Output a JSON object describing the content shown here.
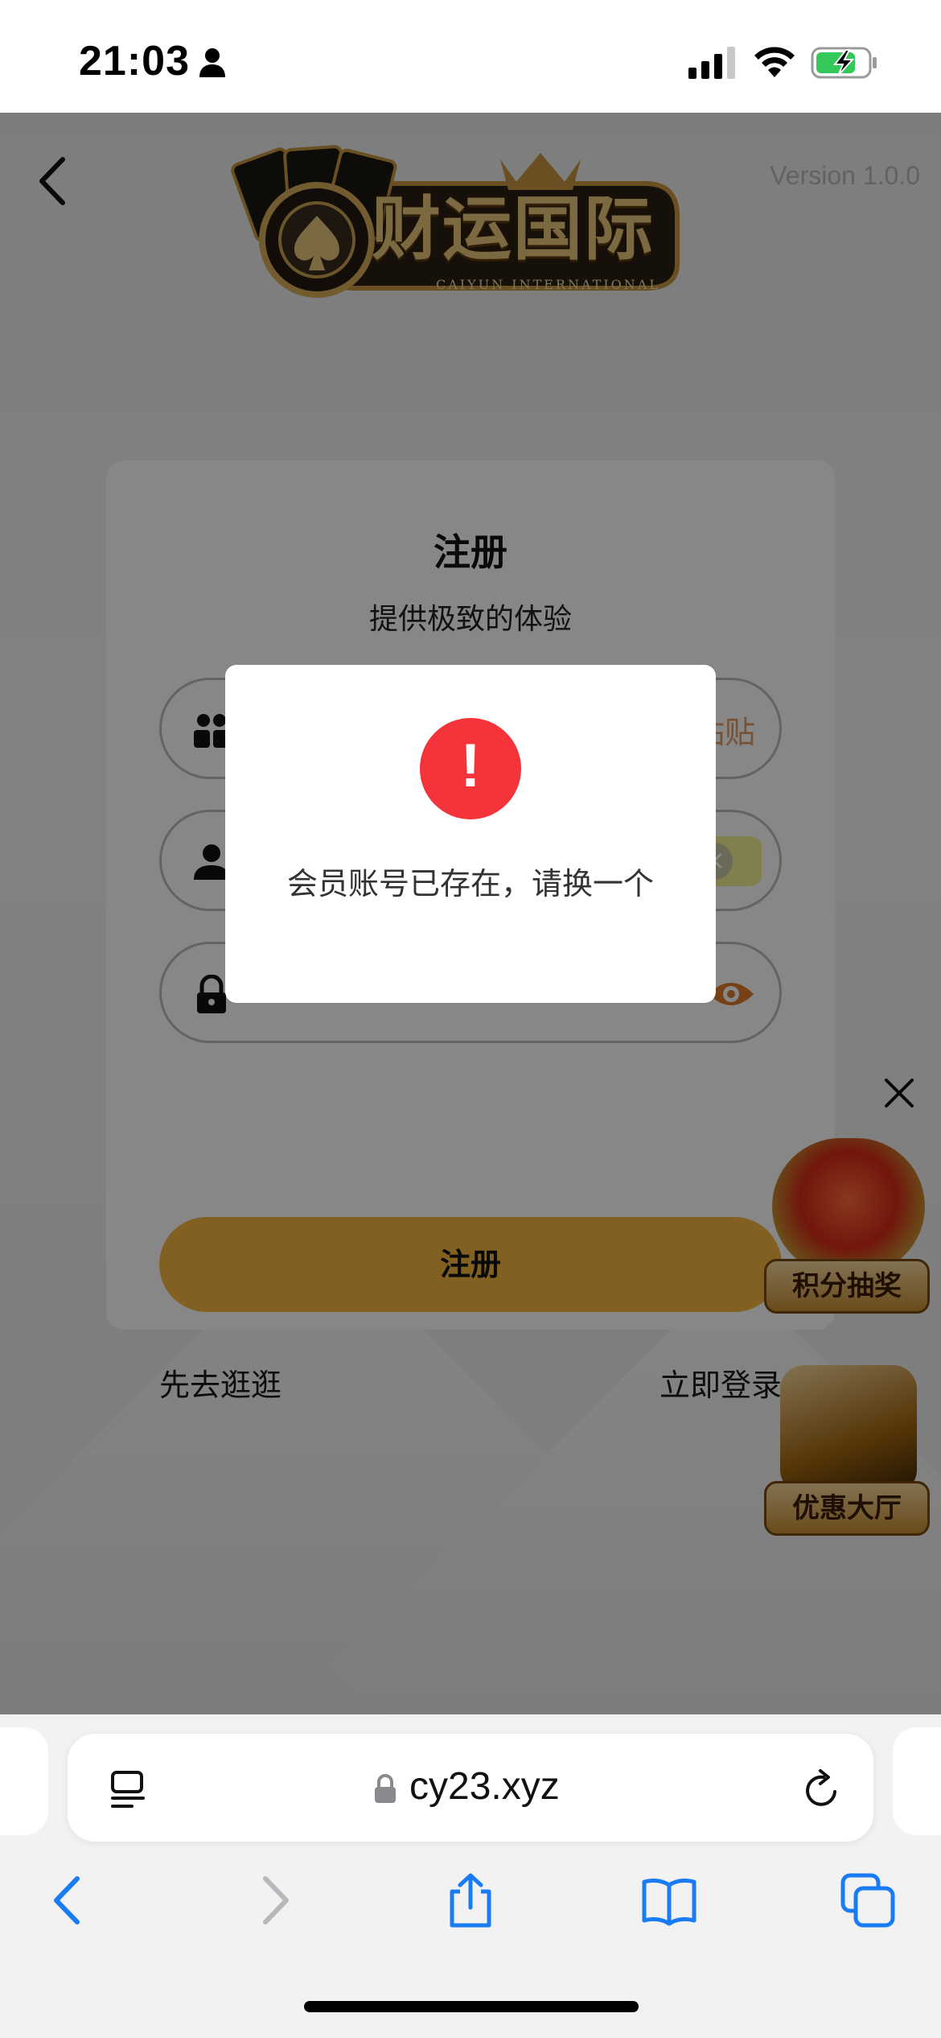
{
  "status_bar": {
    "time": "21:03"
  },
  "page": {
    "version": "Version 1.0.0",
    "logo": {
      "title": "财运国际",
      "subtitle": "CAIYUN INTERNATIONAL"
    },
    "form": {
      "title": "注册",
      "subtitle": "提供极致的体验",
      "field1_right": "粘贴",
      "submit_label": "注册",
      "browse_link": "先去逛逛",
      "login_link": "立即登录"
    },
    "promos": [
      {
        "label": "积分抽奖"
      },
      {
        "label": "优惠大厅"
      }
    ]
  },
  "modal": {
    "icon_text": "!",
    "message": "会员账号已存在，请换一个"
  },
  "browser": {
    "url": "cy23.xyz"
  },
  "colors": {
    "accent_gold": "#f4b63f",
    "alert_red": "#f5333a",
    "ios_blue": "#1a7cf5"
  }
}
